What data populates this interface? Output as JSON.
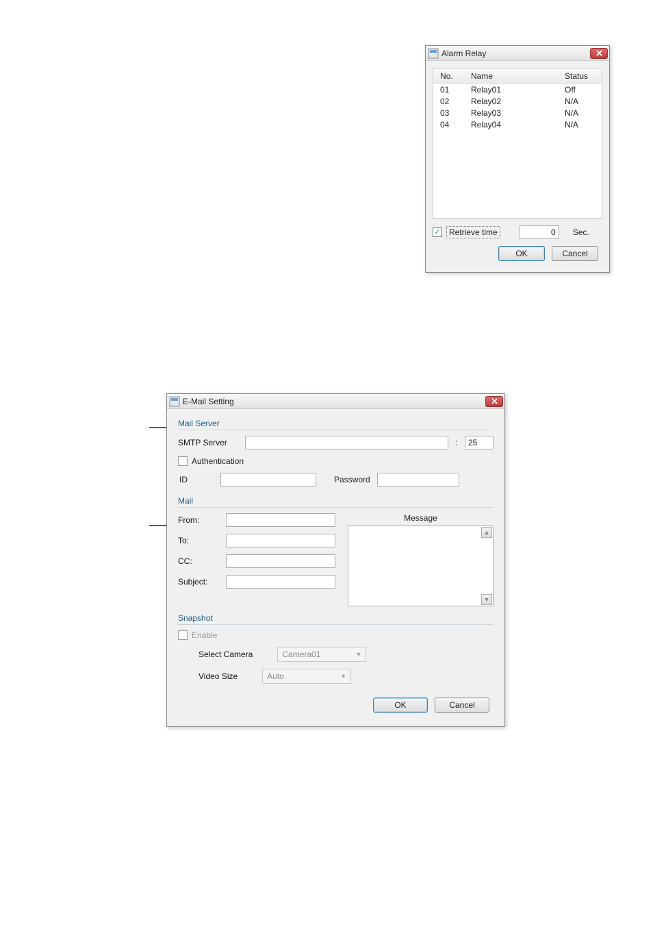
{
  "alarmRelay": {
    "title": "Alarm Relay",
    "columns": {
      "no": "No.",
      "name": "Name",
      "status": "Status"
    },
    "rows": [
      {
        "no": "01",
        "name": "Relay01",
        "status": "Off"
      },
      {
        "no": "02",
        "name": "Relay02",
        "status": "N/A"
      },
      {
        "no": "03",
        "name": "Relay03",
        "status": "N/A"
      },
      {
        "no": "04",
        "name": "Relay04",
        "status": "N/A"
      }
    ],
    "retrieve": {
      "label": "Retrieve time",
      "value": "0",
      "unit": "Sec."
    },
    "buttons": {
      "ok": "OK",
      "cancel": "Cancel"
    }
  },
  "email": {
    "title": "E-Mail Setting",
    "mailServer": {
      "label": "Mail Server",
      "smtpLabel": "SMTP Server",
      "smtpValue": "",
      "colon": ":",
      "port": "25",
      "authLabel": "Authentication",
      "idLabel": "ID",
      "idValue": "",
      "passwordLabel": "Password",
      "passwordValue": ""
    },
    "mail": {
      "label": "Mail",
      "messageLabel": "Message",
      "fromLabel": "From:",
      "fromValue": "",
      "toLabel": "To:",
      "toValue": "",
      "ccLabel": "CC:",
      "ccValue": "",
      "subjectLabel": "Subject:",
      "subjectValue": "",
      "messageValue": ""
    },
    "snapshot": {
      "label": "Snapshot",
      "enableLabel": "Enable",
      "selectCameraLabel": "Select Camera",
      "selectCameraValue": "Camera01",
      "videoSizeLabel": "Video Size",
      "videoSizeValue": "Auto"
    },
    "buttons": {
      "ok": "OK",
      "cancel": "Cancel"
    }
  }
}
